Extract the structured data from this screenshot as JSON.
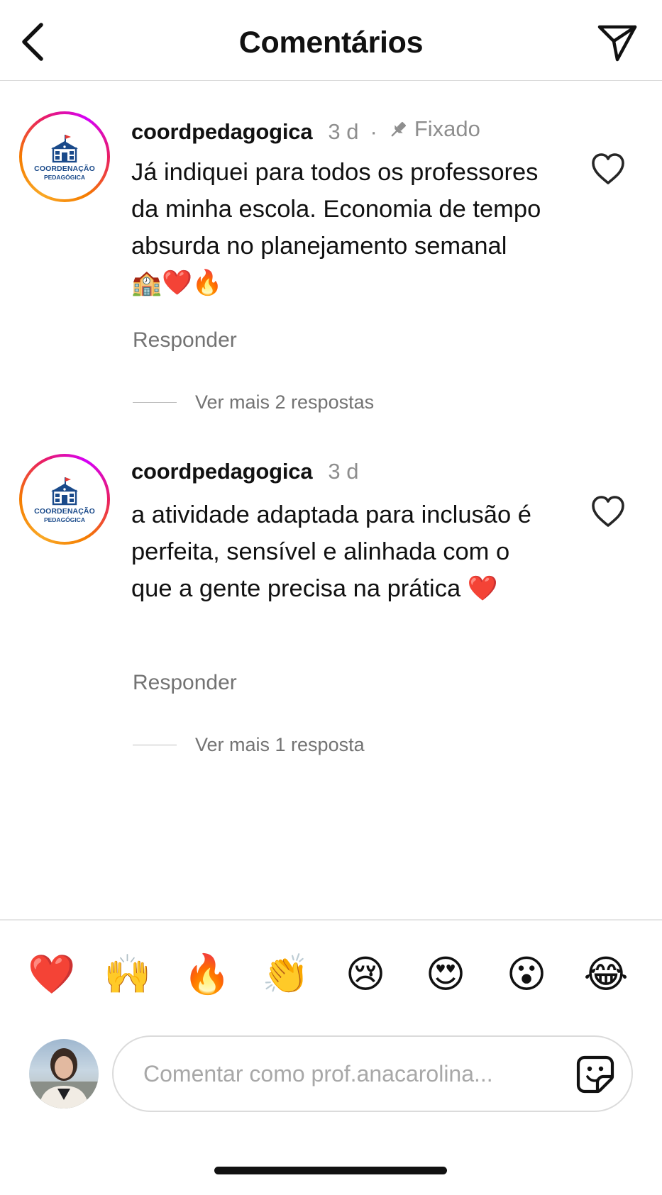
{
  "header": {
    "title": "Comentários"
  },
  "comments": [
    {
      "avatar_line1": "COORDENAÇÃO",
      "avatar_line2": "PEDAGÓGICA",
      "username": "coordpedagogica",
      "time": "3 d",
      "separator": "·",
      "pinned_label": "Fixado",
      "text": "Já indiquei para todos os professores da minha escola. Economia de tempo absurda no planejamento semanal 🏫❤️🔥",
      "reply_label": "Responder",
      "more_replies": "Ver mais 2 respostas"
    },
    {
      "avatar_line1": "COORDENAÇÃO",
      "avatar_line2": "PEDAGÓGICA",
      "username": "coordpedagogica",
      "time": "3 d",
      "text": "a atividade adaptada para inclusão é perfeita, sensível e alinhada com o que a gente precisa na prática ❤️",
      "reply_label": "Responder",
      "more_replies": "Ver mais 1 resposta"
    }
  ],
  "quick_reactions": [
    "❤️",
    "🙌",
    "🔥",
    "👏",
    "😢",
    "😍",
    "😮",
    "😂"
  ],
  "composer": {
    "placeholder": "Comentar como prof.anacarolina..."
  },
  "colors": {
    "text_primary": "#111111",
    "text_secondary": "#8e8e8e",
    "divider": "#dbdbdb",
    "avatar_brand": "#1a4a8a"
  }
}
